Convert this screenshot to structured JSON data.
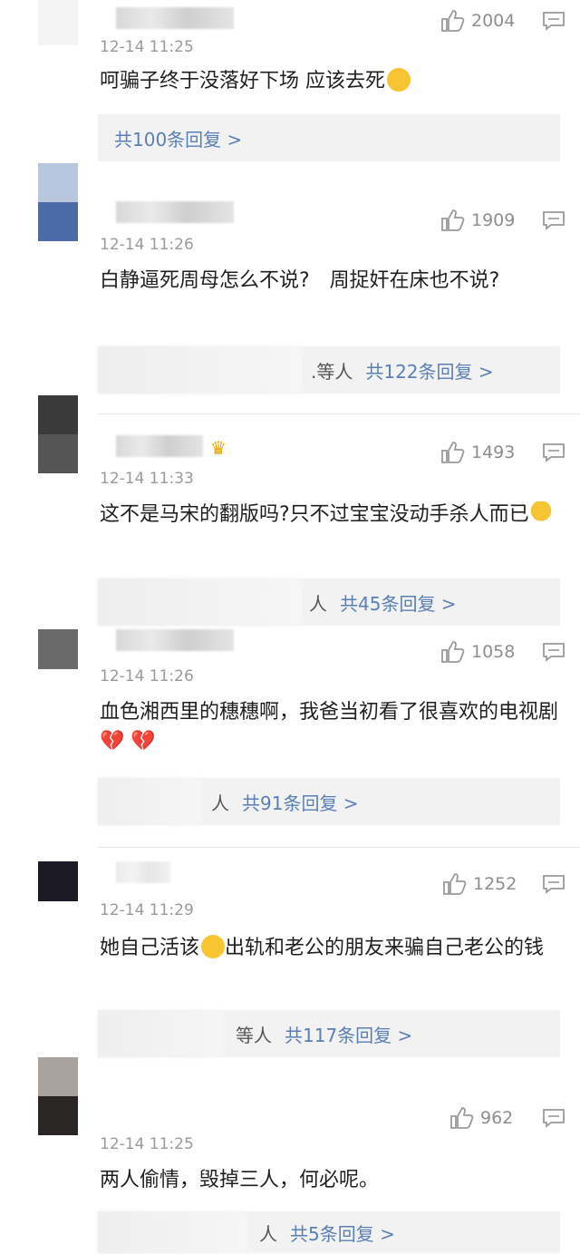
{
  "comments": [
    {
      "time": "12-14 11:25",
      "likes": "2004",
      "text": "呵骗子终于没落好下场 应该去死",
      "reply_prefix": "",
      "reply_link": "共100条回复 >"
    },
    {
      "time": "12-14 11:26",
      "likes": "1909",
      "text": "白静逼死周母怎么不说?　周捉奸在床也不说?",
      "reply_prefix": ".等人",
      "reply_link": "共122条回复 >"
    },
    {
      "time": "12-14 11:33",
      "likes": "1493",
      "text": "这不是马宋的翻版吗?只不过宝宝没动手杀人而已",
      "reply_prefix": "人",
      "reply_link": "共45条回复 >"
    },
    {
      "time": "12-14 11:26",
      "likes": "1058",
      "text": "血色湘西里的穗穗啊，我爸当初看了很喜欢的电视剧",
      "reply_prefix": "人",
      "reply_link": "共91条回复 >"
    },
    {
      "time": "12-14 11:29",
      "likes": "1252",
      "text_before_emoji": "她自己活该",
      "text_after_emoji": "出轨和老公的朋友来骗自己老公的钱",
      "reply_prefix": "等人",
      "reply_link": "共117条回复 >"
    },
    {
      "time": "12-14 11:25",
      "likes": "962",
      "text": "两人偷情，毁掉三人，何必呢。",
      "reply_prefix": "人",
      "reply_link": "共5条回复 >"
    }
  ],
  "colors": {
    "link": "#5a7fb5",
    "time": "#9a9a9a",
    "reply_bg": "#f2f2f2"
  },
  "icons": [
    "thumbs-up-icon",
    "comment-icon",
    "smile-emoji",
    "hands-emoji",
    "broken-heart-emoji",
    "crown-icon"
  ]
}
